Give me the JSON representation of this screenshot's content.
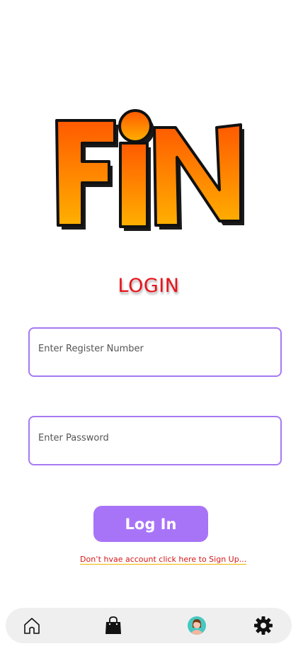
{
  "logo": {
    "text": "FiN",
    "colors": {
      "top": "#ff5a00",
      "bottom": "#ffb000",
      "outline": "#111111"
    }
  },
  "login": {
    "title": "LOGIN",
    "register_placeholder": "Enter Register Number",
    "password_placeholder": "Enter Password",
    "button_label": "Log In",
    "signup_link": "Don’t hvae account click here to Sign Up..."
  },
  "bottom_nav": {
    "items": [
      {
        "icon": "home-icon"
      },
      {
        "icon": "shopping-bag-icon"
      },
      {
        "icon": "user-avatar-icon"
      },
      {
        "icon": "gear-icon"
      }
    ]
  },
  "colors": {
    "accent": "#a874f7",
    "field_border": "#a779f2",
    "title_red": "#e8141b",
    "link_red": "#d31717",
    "link_underline": "#f0b400",
    "nav_background": "#efefef"
  }
}
